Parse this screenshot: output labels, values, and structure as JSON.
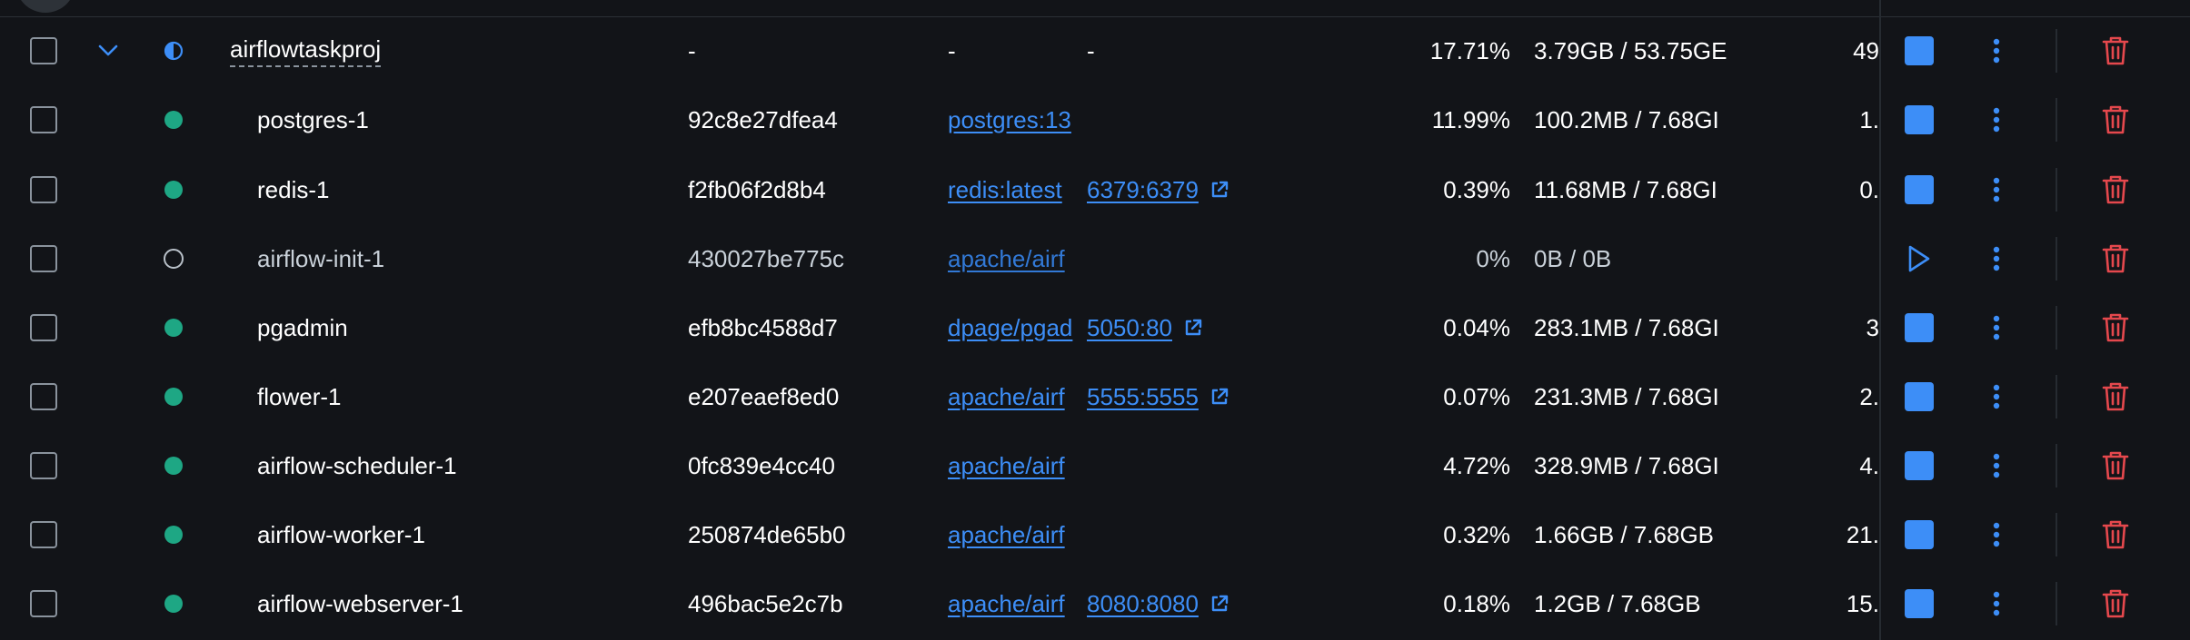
{
  "project": {
    "name": "airflowtaskproj",
    "container_id": "-",
    "image": "-",
    "ports": "-",
    "cpu": "17.71%",
    "memory": "3.79GB / 53.75GE",
    "net": "49"
  },
  "containers": [
    {
      "name": "postgres-1",
      "id": "92c8e27dfea4",
      "image": "postgres:13",
      "ports": "",
      "cpu": "11.99%",
      "memory": "100.2MB / 7.68GI",
      "net": "1.",
      "running": true
    },
    {
      "name": "redis-1",
      "id": "f2fb06f2d8b4",
      "image": "redis:latest",
      "ports": "6379:6379",
      "cpu": "0.39%",
      "memory": "11.68MB / 7.68GI",
      "net": "0.",
      "running": true
    },
    {
      "name": "airflow-init-1",
      "id": "430027be775c",
      "image": "apache/airf",
      "ports": "",
      "cpu": "0%",
      "memory": "0B / 0B",
      "net": "",
      "running": false
    },
    {
      "name": "pgadmin",
      "id": "efb8bc4588d7",
      "image": "dpage/pgad",
      "ports": "5050:80",
      "cpu": "0.04%",
      "memory": "283.1MB / 7.68GI",
      "net": "3",
      "running": true
    },
    {
      "name": "flower-1",
      "id": "e207eaef8ed0",
      "image": "apache/airf",
      "ports": "5555:5555",
      "cpu": "0.07%",
      "memory": "231.3MB / 7.68GI",
      "net": "2.",
      "running": true
    },
    {
      "name": "airflow-scheduler-1",
      "id": "0fc839e4cc40",
      "image": "apache/airf",
      "ports": "",
      "cpu": "4.72%",
      "memory": "328.9MB / 7.68GI",
      "net": "4.",
      "running": true
    },
    {
      "name": "airflow-worker-1",
      "id": "250874de65b0",
      "image": "apache/airf",
      "ports": "",
      "cpu": "0.32%",
      "memory": "1.66GB / 7.68GB",
      "net": "21.",
      "running": true
    },
    {
      "name": "airflow-webserver-1",
      "id": "496bac5e2c7b",
      "image": "apache/airf",
      "ports": "8080:8080",
      "cpu": "0.18%",
      "memory": "1.2GB / 7.68GB",
      "net": "15.",
      "running": true
    }
  ],
  "colors": {
    "background": "#121418",
    "accent": "#3d8ef7",
    "running": "#1ea784",
    "danger": "#e5484d"
  },
  "icons": {
    "expand": "chevron-down-icon",
    "project_status": "half-circle-icon",
    "running": "status-dot-icon",
    "exited": "status-circle-outline-icon",
    "stop": "stop-icon",
    "start": "play-icon",
    "menu": "kebab-menu-icon",
    "delete": "trash-icon",
    "open_port": "external-link-icon"
  }
}
